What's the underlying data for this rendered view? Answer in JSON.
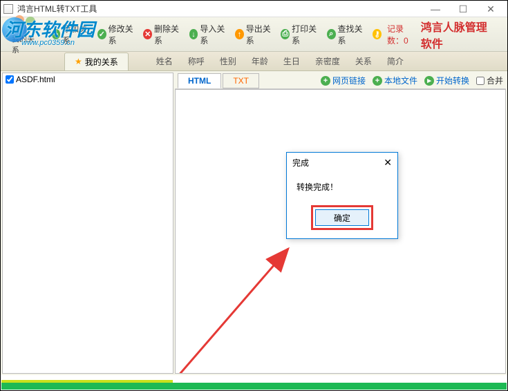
{
  "window": {
    "title": "鸿言HTML转TXT工具"
  },
  "watermark": {
    "text": "河东软件园",
    "url": "www.pc0359.cn"
  },
  "ribbon": {
    "my_relations_btn": "我的关系",
    "add": "添加关系",
    "edit": "修改关系",
    "del": "删除关系",
    "import": "导入关系",
    "export": "导出关系",
    "print": "打印关系",
    "find": "查找关系",
    "record_label": "记录数：",
    "record_count": "0",
    "app_title": "鸿言人脉管理软件"
  },
  "subbar": {
    "my_relations_tab": "我的关系",
    "cols": [
      "姓名",
      "称呼",
      "性别",
      "年龄",
      "生日",
      "亲密度",
      "关系",
      "简介"
    ]
  },
  "files": [
    {
      "checked": true,
      "name": "ASDF.html"
    }
  ],
  "right": {
    "tab_html": "HTML",
    "tab_txt": "TXT",
    "web_link": "网页链接",
    "local_file": "本地文件",
    "start": "开始转换",
    "merge": "合并"
  },
  "dialog": {
    "title": "完成",
    "message": "转换完成！",
    "ok": "确定"
  }
}
